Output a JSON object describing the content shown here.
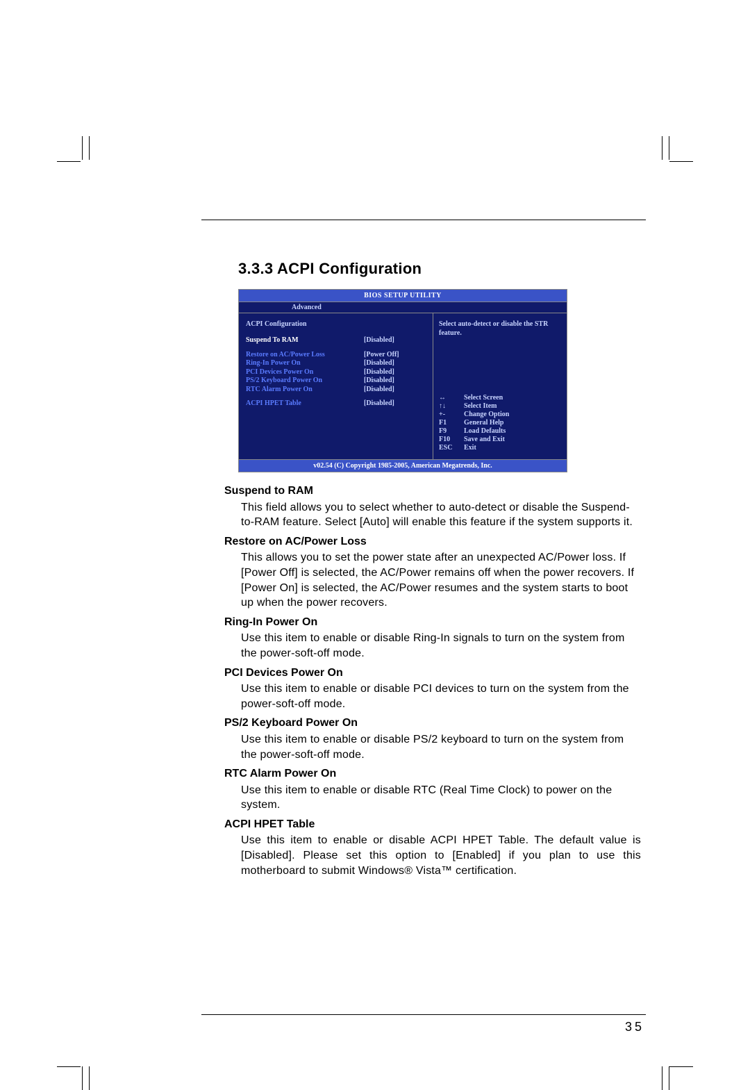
{
  "section_title": "3.3.3 ACPI Configuration",
  "page_number": "35",
  "bios": {
    "header": "BIOS SETUP UTILITY",
    "tab": "Advanced",
    "panel_title": "ACPI Configuration",
    "rows": [
      {
        "label": "Suspend To RAM",
        "value": "[Disabled]",
        "selected": true
      },
      {
        "gap": true
      },
      {
        "label": "Restore on AC/Power Loss",
        "value": "[Power Off]"
      },
      {
        "label": "Ring-In Power On",
        "value": "[Disabled]"
      },
      {
        "label": "PCI Devices Power On",
        "value": "[Disabled]"
      },
      {
        "label": "PS/2 Keyboard Power On",
        "value": "[Disabled]"
      },
      {
        "label": "RTC Alarm Power On",
        "value": "[Disabled]"
      },
      {
        "gap": true
      },
      {
        "label": "ACPI HPET Table",
        "value": "[Disabled]"
      }
    ],
    "help": "Select auto-detect or disable the STR feature.",
    "keys": [
      {
        "k": "↔",
        "d": "Select Screen"
      },
      {
        "k": "↑↓",
        "d": "Select Item"
      },
      {
        "k": "+-",
        "d": "Change Option"
      },
      {
        "k": "F1",
        "d": "General Help"
      },
      {
        "k": "F9",
        "d": "Load Defaults"
      },
      {
        "k": "F10",
        "d": "Save and Exit"
      },
      {
        "k": "ESC",
        "d": "Exit"
      }
    ],
    "footer": "v02.54 (C) Copyright 1985-2005, American Megatrends, Inc."
  },
  "items": [
    {
      "title": "Suspend to RAM",
      "body": "This field allows you to select whether to auto-detect or disable the Suspend-to-RAM feature. Select [Auto] will enable this feature if the system supports it."
    },
    {
      "title": "Restore on AC/Power Loss",
      "body": "This allows you to set the power state after an unexpected AC/Power loss. If [Power Off] is selected, the AC/Power remains off when the power recovers. If [Power On] is selected, the AC/Power resumes and the system starts to boot up when the power recovers."
    },
    {
      "title": "Ring-In Power On",
      "body": "Use this item to enable or disable Ring-In signals to turn on the system from the power-soft-off mode."
    },
    {
      "title": "PCI Devices Power On",
      "body": "Use this item to enable or disable PCI devices to turn on the system from the power-soft-off mode."
    },
    {
      "title": "PS/2 Keyboard Power On",
      "body": "Use this item to enable or disable PS/2 keyboard to turn on the system from the power-soft-off mode."
    },
    {
      "title": "RTC Alarm Power On",
      "body": "Use this item to enable or disable RTC (Real Time Clock) to power on the system."
    },
    {
      "title": "ACPI HPET Table",
      "body": "Use this item to enable or disable ACPI HPET Table. The default value is [Disabled]. Please set this option to [Enabled] if you plan to use this motherboard to submit Windows® Vista™ certification."
    }
  ]
}
